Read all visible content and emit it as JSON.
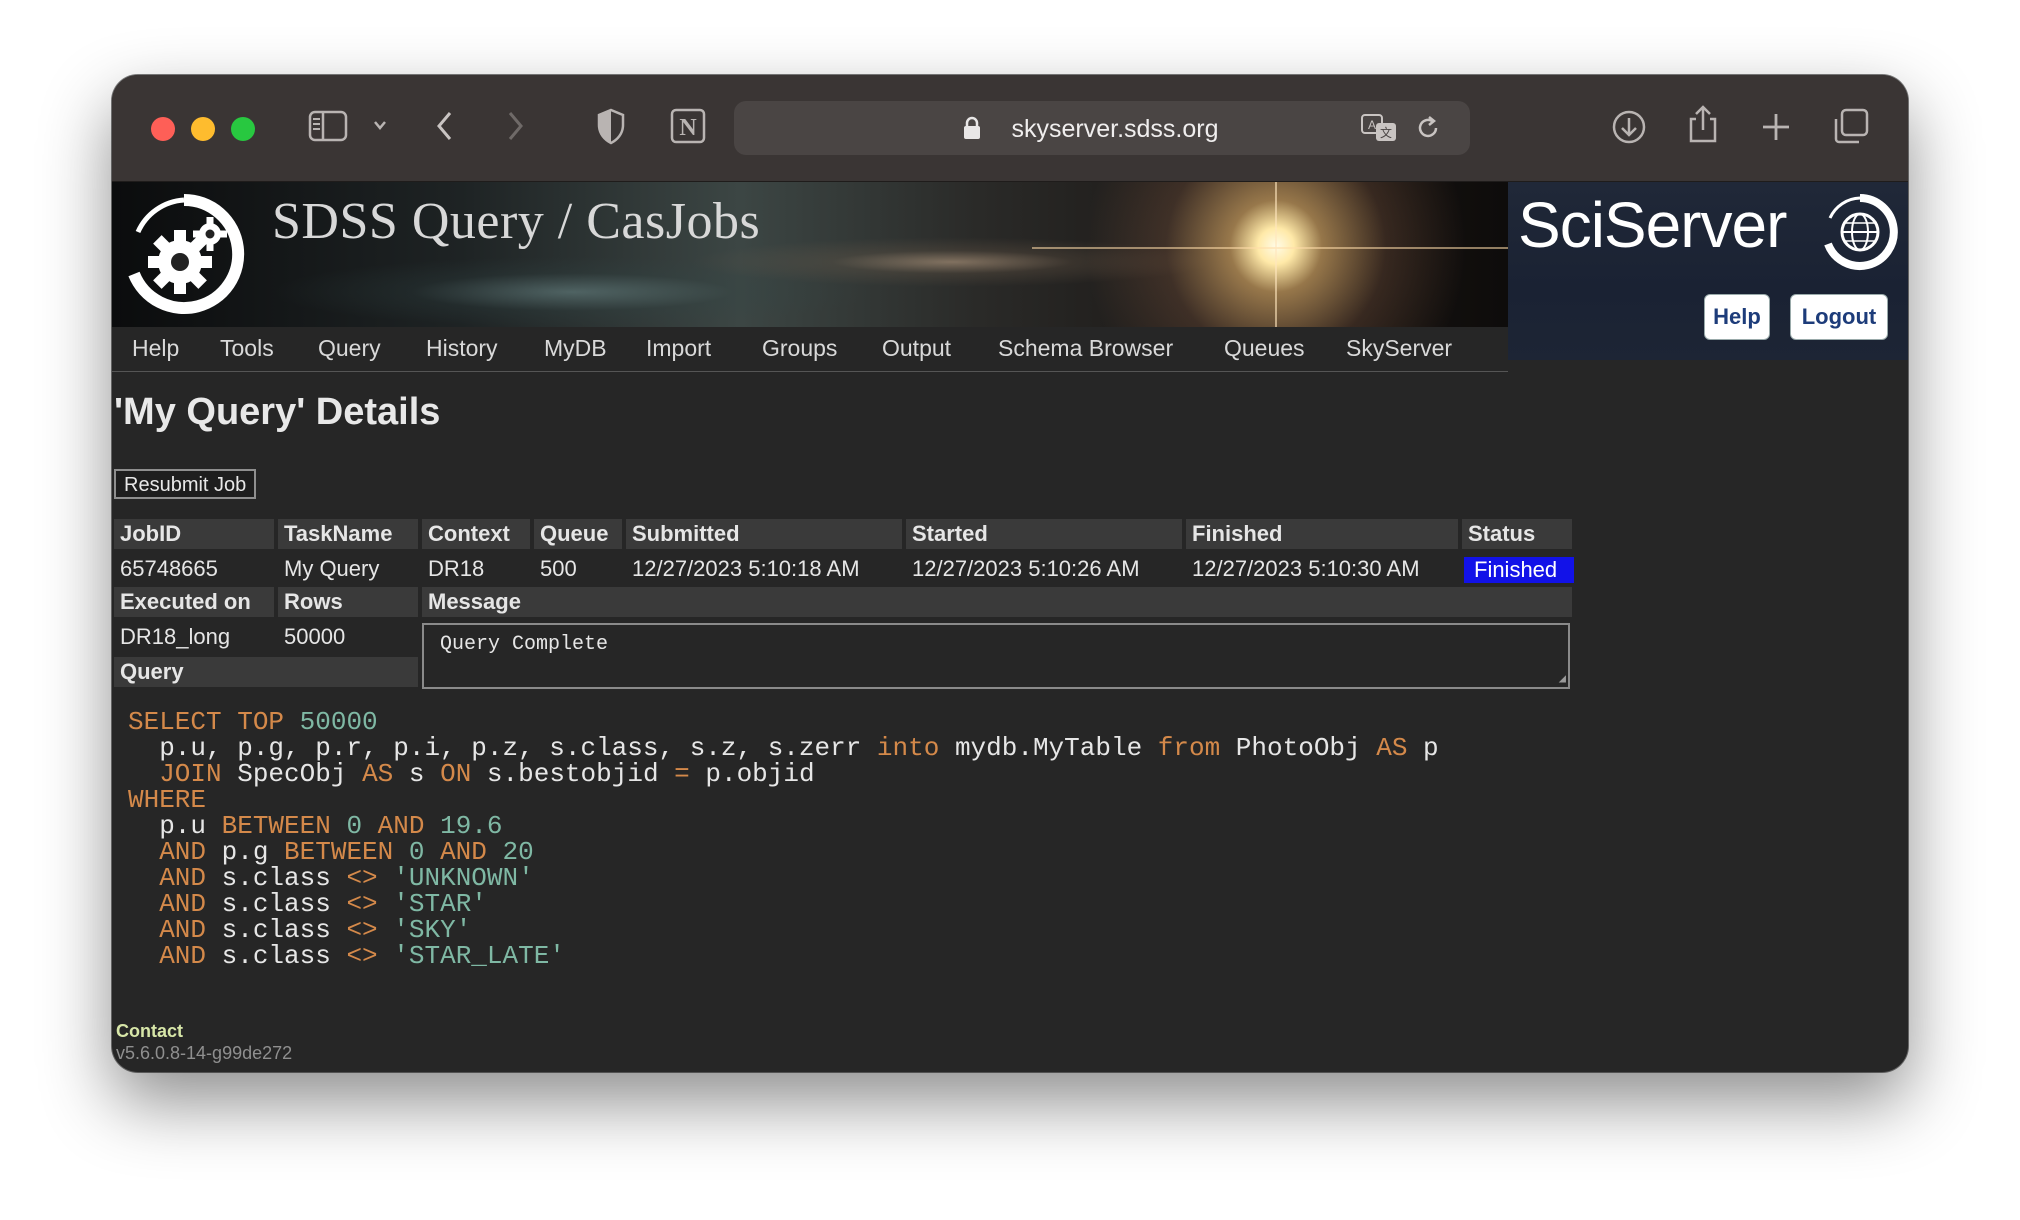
{
  "browser": {
    "url": "skyserver.sdss.org"
  },
  "banner": {
    "title": "SDSS Query / CasJobs",
    "brand": "SciServer",
    "help_label": "Help",
    "logout_label": "Logout"
  },
  "nav": {
    "items": [
      "Help",
      "Tools",
      "Query",
      "History",
      "MyDB",
      "Import",
      "Groups",
      "Output",
      "Schema Browser",
      "Queues",
      "SkyServer"
    ]
  },
  "page": {
    "heading": "'My Query' Details",
    "resubmit_label": "Resubmit Job"
  },
  "job": {
    "headers": {
      "jobid": "JobID",
      "taskname": "TaskName",
      "context": "Context",
      "queue": "Queue",
      "submitted": "Submitted",
      "started": "Started",
      "finished": "Finished",
      "status": "Status",
      "executed_on": "Executed on",
      "rows": "Rows",
      "message": "Message",
      "query": "Query"
    },
    "jobid": "65748665",
    "taskname": "My Query",
    "context": "DR18",
    "queue": "500",
    "submitted": "12/27/2023 5:10:18 AM",
    "started": "12/27/2023 5:10:26 AM",
    "finished": "12/27/2023 5:10:30 AM",
    "status": "Finished",
    "executed_on": "DR18_long",
    "rows": "50000",
    "message": "Query Complete"
  },
  "query_lines": [
    [
      {
        "t": "SELECT TOP ",
        "c": "kw"
      },
      {
        "t": "50000",
        "c": "num"
      }
    ],
    [
      {
        "t": "  p.u, p.g, p.r, p.i, p.z, s.class, s.z, s.zerr ",
        "c": ""
      },
      {
        "t": "into",
        "c": "kw"
      },
      {
        "t": " mydb.MyTable ",
        "c": ""
      },
      {
        "t": "from",
        "c": "kw"
      },
      {
        "t": " PhotoObj ",
        "c": ""
      },
      {
        "t": "AS",
        "c": "kw"
      },
      {
        "t": " p",
        "c": ""
      }
    ],
    [
      {
        "t": "  JOIN",
        "c": "kw"
      },
      {
        "t": " SpecObj ",
        "c": ""
      },
      {
        "t": "AS",
        "c": "kw"
      },
      {
        "t": " s ",
        "c": ""
      },
      {
        "t": "ON",
        "c": "kw"
      },
      {
        "t": " s.bestobjid ",
        "c": ""
      },
      {
        "t": "=",
        "c": "kw"
      },
      {
        "t": " p.objid",
        "c": ""
      }
    ],
    [
      {
        "t": "WHERE",
        "c": "kw"
      }
    ],
    [
      {
        "t": "  p.u ",
        "c": ""
      },
      {
        "t": "BETWEEN",
        "c": "kw"
      },
      {
        "t": " ",
        "c": ""
      },
      {
        "t": "0",
        "c": "num"
      },
      {
        "t": " ",
        "c": ""
      },
      {
        "t": "AND",
        "c": "kw"
      },
      {
        "t": " ",
        "c": ""
      },
      {
        "t": "19.6",
        "c": "num"
      }
    ],
    [
      {
        "t": "  AND",
        "c": "kw"
      },
      {
        "t": " p.g ",
        "c": ""
      },
      {
        "t": "BETWEEN",
        "c": "kw"
      },
      {
        "t": " ",
        "c": ""
      },
      {
        "t": "0",
        "c": "num"
      },
      {
        "t": " ",
        "c": ""
      },
      {
        "t": "AND",
        "c": "kw"
      },
      {
        "t": " ",
        "c": ""
      },
      {
        "t": "20",
        "c": "num"
      }
    ],
    [
      {
        "t": "  AND",
        "c": "kw"
      },
      {
        "t": " s.class ",
        "c": ""
      },
      {
        "t": "<>",
        "c": "kw"
      },
      {
        "t": " ",
        "c": ""
      },
      {
        "t": "'UNKNOWN'",
        "c": "str"
      }
    ],
    [
      {
        "t": "  AND",
        "c": "kw"
      },
      {
        "t": " s.class ",
        "c": ""
      },
      {
        "t": "<>",
        "c": "kw"
      },
      {
        "t": " ",
        "c": ""
      },
      {
        "t": "'STAR'",
        "c": "str"
      }
    ],
    [
      {
        "t": "  AND",
        "c": "kw"
      },
      {
        "t": " s.class ",
        "c": ""
      },
      {
        "t": "<>",
        "c": "kw"
      },
      {
        "t": " ",
        "c": ""
      },
      {
        "t": "'SKY'",
        "c": "str"
      }
    ],
    [
      {
        "t": "  AND",
        "c": "kw"
      },
      {
        "t": " s.class ",
        "c": ""
      },
      {
        "t": "<>",
        "c": "kw"
      },
      {
        "t": " ",
        "c": ""
      },
      {
        "t": "'STAR_LATE'",
        "c": "str"
      }
    ]
  ],
  "footer": {
    "contact": "Contact",
    "version": "v5.6.0.8-14-g99de272"
  },
  "colors": {
    "status_badge": "#1212e8",
    "keyword": "#d4894a",
    "literal": "#7fb8a4"
  }
}
